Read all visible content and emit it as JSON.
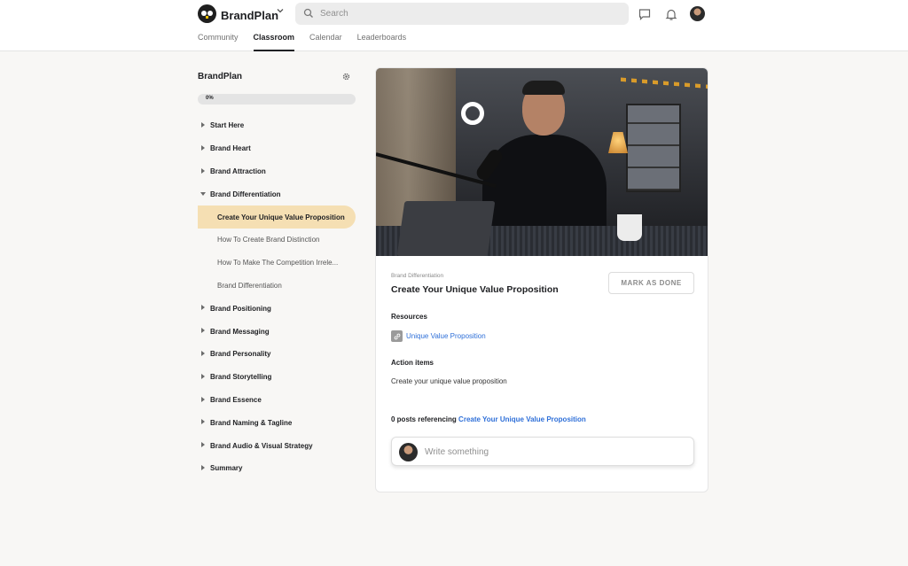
{
  "header": {
    "brand_name": "BrandPlan",
    "search_placeholder": "Search",
    "tabs": [
      {
        "label": "Community",
        "active": false
      },
      {
        "label": "Classroom",
        "active": true
      },
      {
        "label": "Calendar",
        "active": false
      },
      {
        "label": "Leaderboards",
        "active": false
      }
    ],
    "icons": [
      "chevron-down-icon",
      "search-icon",
      "chat-icon",
      "bell-icon",
      "avatar"
    ]
  },
  "sidebar": {
    "title": "BrandPlan",
    "progress_label": "0%",
    "progress_value": 0,
    "items": [
      {
        "label": "Start Here",
        "type": "module",
        "expanded": false
      },
      {
        "label": "Brand Heart",
        "type": "module",
        "expanded": false
      },
      {
        "label": "Brand Attraction",
        "type": "module",
        "expanded": false
      },
      {
        "label": "Brand Differentiation",
        "type": "module",
        "expanded": true
      },
      {
        "label": "Create Your Unique Value Proposition",
        "type": "lesson",
        "active": true
      },
      {
        "label": "How To Create Brand Distinction",
        "type": "lesson",
        "active": false
      },
      {
        "label": "How To Make The Competition Irrele...",
        "type": "lesson",
        "active": false
      },
      {
        "label": "Brand Differentiation",
        "type": "lesson",
        "active": false
      },
      {
        "label": "Brand Positioning",
        "type": "module",
        "expanded": false
      },
      {
        "label": "Brand Messaging",
        "type": "module",
        "expanded": false
      },
      {
        "label": "Brand Personality",
        "type": "module",
        "expanded": false
      },
      {
        "label": "Brand Storytelling",
        "type": "module",
        "expanded": false
      },
      {
        "label": "Brand Essence",
        "type": "module",
        "expanded": false
      },
      {
        "label": "Brand Naming & Tagline",
        "type": "module",
        "expanded": false
      },
      {
        "label": "Brand Audio & Visual Strategy",
        "type": "module",
        "expanded": false
      },
      {
        "label": "Summary",
        "type": "module",
        "expanded": false
      }
    ]
  },
  "lesson": {
    "breadcrumb": "Brand Differentiation",
    "title": "Create Your Unique Value Proposition",
    "mark_done_label": "MARK AS DONE",
    "resources_title": "Resources",
    "resource_link": "Unique Value Proposition",
    "action_items_title": "Action items",
    "action_item_text": "Create your unique value proposition",
    "posts_prefix": "0 posts referencing",
    "posts_link": "Create Your Unique Value Proposition",
    "composer_placeholder": "Write something"
  },
  "colors": {
    "active_lesson_bg": "#f5dfb3",
    "link": "#2e6fd8",
    "page_bg": "#f8f7f5"
  }
}
